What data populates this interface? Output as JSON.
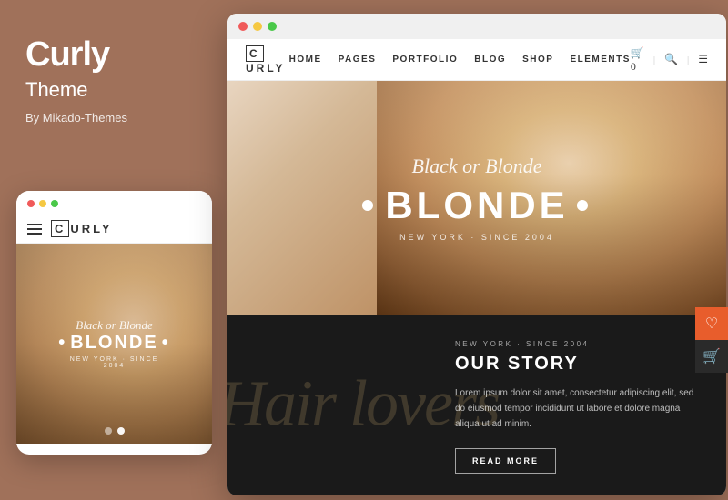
{
  "sidebar": {
    "title": "Curly",
    "subtitle": "Theme",
    "by": "By Mikado-Themes"
  },
  "mobile": {
    "logo": "CURLY",
    "logo_box_letter": "C",
    "hero_cursive": "Black or Blonde",
    "hero_title": "BLONDE",
    "hero_dot": "•",
    "hero_location": "NEW YORK · SINCE 2004",
    "dots": [
      "red",
      "yellow",
      "green"
    ]
  },
  "desktop": {
    "titlebar_dots": [
      "red",
      "yellow",
      "green"
    ],
    "logo": "URLY",
    "logo_box_letter": "C",
    "nav_items": [
      "HOME",
      "PAGES",
      "PORTFOLIO",
      "BLOG",
      "SHOP",
      "ELEMENTS"
    ],
    "nav_active": "HOME",
    "hero_cursive": "Black or Blonde",
    "hero_title": "BLONDE",
    "hero_dot": "•",
    "hero_location": "NEW YORK · SINCE 2004",
    "story_bg_text": "Hair lovers",
    "story_location": "NEW YORK · SINCE 2004",
    "story_title": "OUR STORY",
    "story_body": "Lorem ipsum dolor sit amet, consectetur adipiscing elit, sed do eiusmod tempor incididunt ut labore et dolore magna aliqua ut ad minim.",
    "story_btn": "READ MORE",
    "fab_icons": [
      "♡",
      "🛒"
    ]
  }
}
